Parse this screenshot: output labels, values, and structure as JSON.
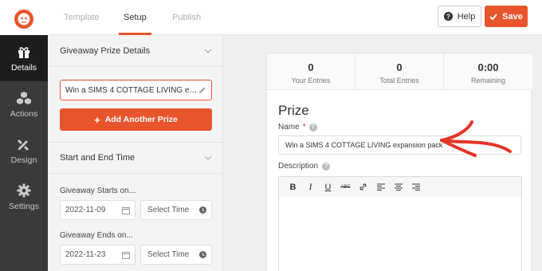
{
  "header": {
    "tabs": [
      {
        "label": "Template",
        "active": false
      },
      {
        "label": "Setup",
        "active": true
      },
      {
        "label": "Publish",
        "active": false
      }
    ],
    "help_label": "Help",
    "save_label": "Save",
    "accent_color": "#e8542b"
  },
  "nav": {
    "items": [
      {
        "label": "Details",
        "icon": "gift-icon",
        "active": true
      },
      {
        "label": "Actions",
        "icon": "cubes-icon",
        "active": false
      },
      {
        "label": "Design",
        "icon": "design-tools-icon",
        "active": false
      },
      {
        "label": "Settings",
        "icon": "gear-icon",
        "active": false
      }
    ]
  },
  "panel": {
    "prize_section_title": "Giveaway Prize Details",
    "prize_value": "Win a SIMS 4 COTTAGE LIVING expansion pack",
    "add_prize_label": "Add Another Prize",
    "time_section_title": "Start and End Time",
    "starts_label": "Giveaway Starts on...",
    "start_date": "2022-11-09",
    "start_time_placeholder": "Select Time",
    "ends_label": "Giveaway Ends on...",
    "end_date": "2022-11-23",
    "end_time_placeholder": "Select Time"
  },
  "preview": {
    "stats": [
      {
        "value": "0",
        "label": "Your Entries"
      },
      {
        "value": "0",
        "label": "Total Entries"
      },
      {
        "value": "0:00",
        "label": "Remaining"
      }
    ],
    "prize_heading": "Prize",
    "name_label": "Name",
    "required_mark": "*",
    "name_value": "Win a SIMS 4 COTTAGE LIVING expansion pack",
    "description_label": "Description",
    "toolbar": [
      "B",
      "I",
      "U",
      "ABC"
    ]
  }
}
